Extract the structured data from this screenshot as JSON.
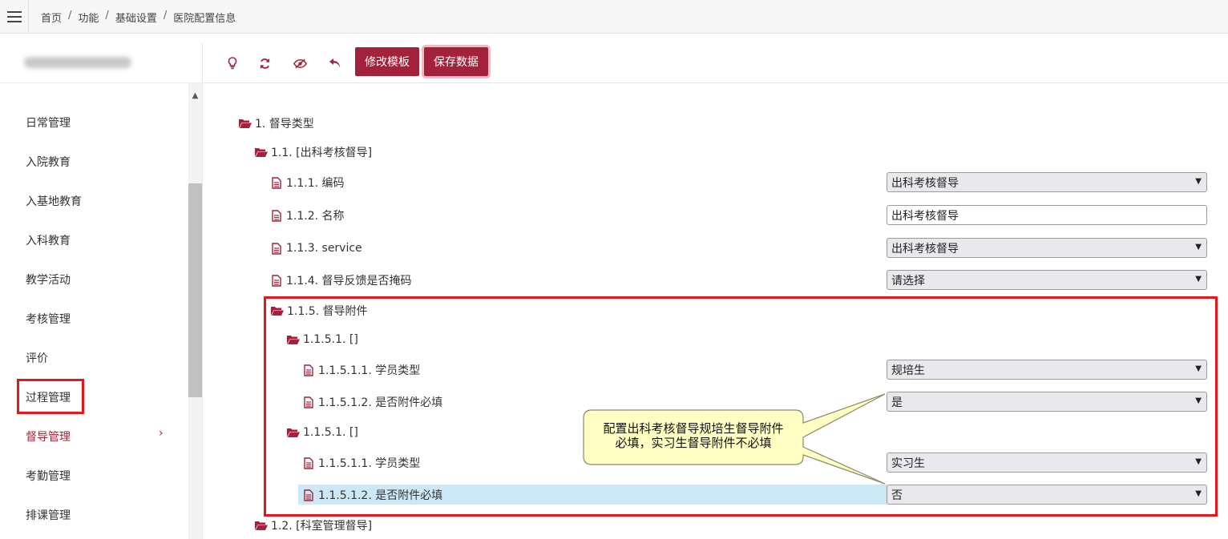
{
  "header": {
    "breadcrumb": [
      "首页",
      "功能",
      "基础设置",
      "医院配置信息"
    ],
    "separator": "/"
  },
  "sidebar": {
    "items": [
      {
        "label": "日常管理"
      },
      {
        "label": "入院教育"
      },
      {
        "label": "入基地教育"
      },
      {
        "label": "入科教育"
      },
      {
        "label": "教学活动"
      },
      {
        "label": "考核管理"
      },
      {
        "label": "评价"
      },
      {
        "label": "过程管理"
      },
      {
        "label": "督导管理",
        "active": true
      },
      {
        "label": "考勤管理"
      },
      {
        "label": "排课管理"
      }
    ]
  },
  "toolbar": {
    "icons": [
      "lightbulb-icon",
      "refresh-icon",
      "hide-icon",
      "undo-icon"
    ],
    "edit_template_label": "修改模板",
    "save_data_label": "保存数据"
  },
  "tree": [
    {
      "label": "1. 督导类型",
      "icon": "folder-open-icon"
    },
    {
      "label": "1.1. [出科考核督导]",
      "icon": "folder-open-icon"
    },
    {
      "label": "1.1.1. 编码",
      "icon": "file-icon",
      "control": "select",
      "value": "出科考核督导"
    },
    {
      "label": "1.1.2. 名称",
      "icon": "file-icon",
      "control": "input",
      "value": "出科考核督导"
    },
    {
      "label": "1.1.3. service",
      "icon": "file-icon",
      "control": "select",
      "value": "出科考核督导"
    },
    {
      "label": "1.1.4. 督导反馈是否掩码",
      "icon": "file-icon",
      "control": "select",
      "value": "请选择"
    },
    {
      "label": "1.1.5. 督导附件",
      "icon": "folder-open-icon"
    },
    {
      "label": "1.1.5.1. []",
      "icon": "folder-open-icon"
    },
    {
      "label": "1.1.5.1.1. 学员类型",
      "icon": "file-icon",
      "control": "select",
      "value": "规培生"
    },
    {
      "label": "1.1.5.1.2. 是否附件必填",
      "icon": "file-icon",
      "control": "select",
      "value": "是"
    },
    {
      "label": "1.1.5.1. []",
      "icon": "folder-open-icon"
    },
    {
      "label": "1.1.5.1.1. 学员类型",
      "icon": "file-icon",
      "control": "select",
      "value": "实习生"
    },
    {
      "label": "1.1.5.1.2. 是否附件必填",
      "icon": "file-icon",
      "control": "select",
      "value": "否",
      "selected": true
    },
    {
      "label": "1.2. [科室管理督导]",
      "icon": "folder-open-icon"
    }
  ],
  "callout": {
    "line1": "配置出科考核督导规培生督导附件",
    "line2": "必填，实习生督导附件不必填"
  },
  "colors": {
    "accent": "#a3213a",
    "annotation_red": "#e8141c",
    "callout_fill": "#ffffc4",
    "selected_row": "#cce8f6"
  }
}
